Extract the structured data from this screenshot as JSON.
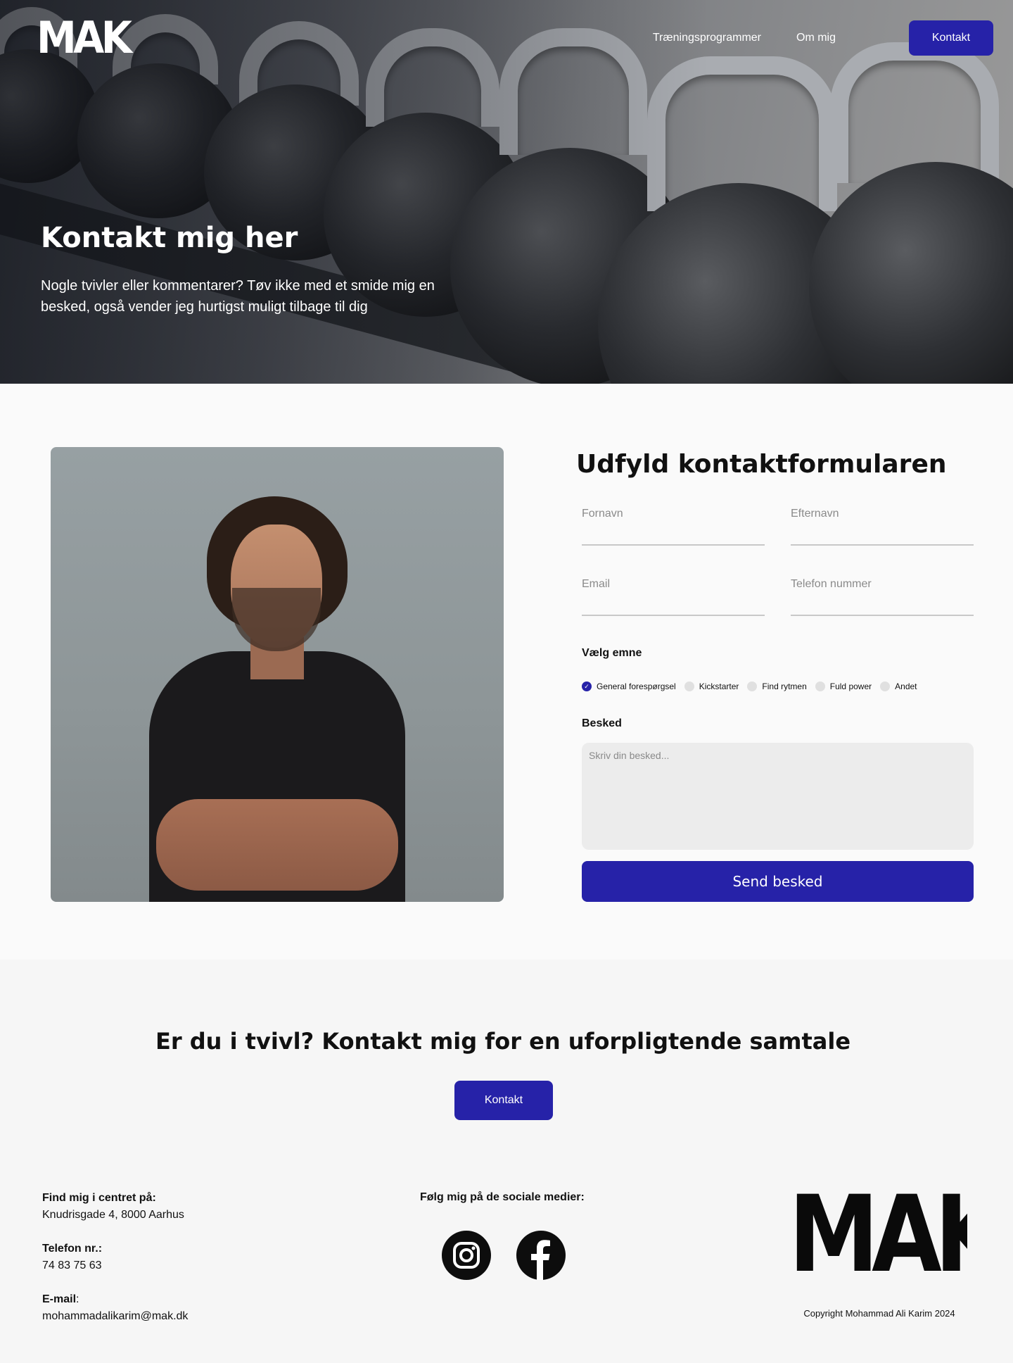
{
  "header": {
    "logo_text": "MAK",
    "nav": [
      {
        "label": "Træningsprogrammer"
      },
      {
        "label": "Om mig"
      }
    ],
    "cta_label": "Kontakt"
  },
  "hero": {
    "title": "Kontakt mig her",
    "text": "Nogle tvivler eller kommentarer? Tøv ikke med et smide mig en besked, også vender jeg hurtigst muligt tilbage til dig"
  },
  "form": {
    "title": "Udfyld kontaktformularen",
    "fields": {
      "first_name": {
        "placeholder": "Fornavn",
        "value": ""
      },
      "last_name": {
        "placeholder": "Efternavn",
        "value": ""
      },
      "email": {
        "placeholder": "Email",
        "value": ""
      },
      "phone": {
        "placeholder": "Telefon nummer",
        "value": ""
      }
    },
    "subject_label": "Vælg emne",
    "subjects": [
      {
        "label": "General forespørgsel",
        "checked": true
      },
      {
        "label": "Kickstarter",
        "checked": false
      },
      {
        "label": "Find rytmen",
        "checked": false
      },
      {
        "label": "Fuld power",
        "checked": false
      },
      {
        "label": "Andet",
        "checked": false
      }
    ],
    "message_label": "Besked",
    "message_placeholder": "Skriv din besked...",
    "submit_label": "Send besked"
  },
  "cta": {
    "title": "Er du i tvivl? Kontakt mig for en uforpligtende samtale",
    "button_label": "Kontakt"
  },
  "footer": {
    "address_label": "Find mig i centret på:",
    "address": "Knudrisgade 4, 8000 Aarhus",
    "phone_label": "Telefon nr.:",
    "phone": "74 83 75 63",
    "email_label": "E-mail",
    "email_suffix": ":",
    "email": "mohammadalikarim@mak.dk",
    "social_title": "Følg mig på de sociale medier:",
    "social_icons": [
      "instagram-icon",
      "facebook-icon"
    ],
    "logo_text": "MAK",
    "copyright": "Copyright Mohammad Ali Karim 2024"
  },
  "colors": {
    "accent": "#2622a8",
    "text": "#111111",
    "background": "#fafafa"
  }
}
